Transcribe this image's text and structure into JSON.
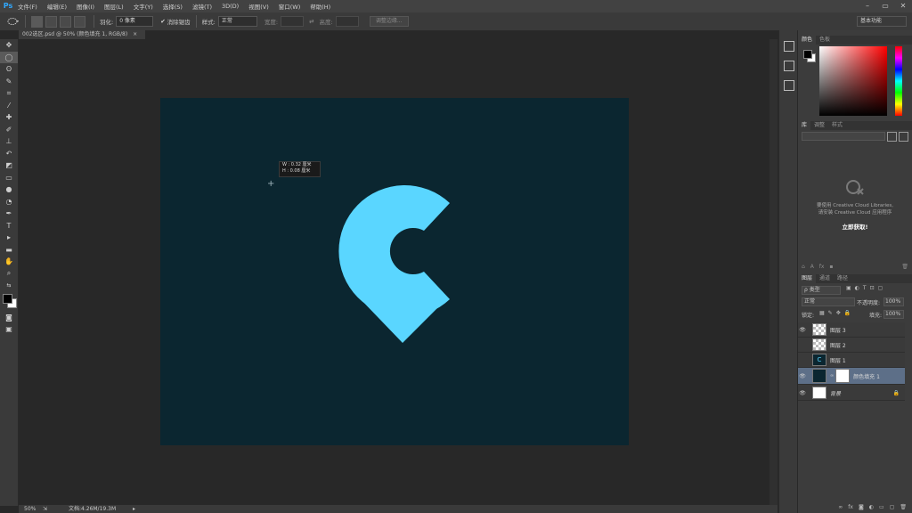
{
  "app": {
    "logo": "Ps"
  },
  "menu": [
    "文件(F)",
    "编辑(E)",
    "图像(I)",
    "图层(L)",
    "文字(Y)",
    "选择(S)",
    "滤镜(T)",
    "3D(D)",
    "视图(V)",
    "窗口(W)",
    "帮助(H)"
  ],
  "window_controls": [
    "–",
    "▭",
    "✕"
  ],
  "options": {
    "feather_label": "羽化:",
    "feather_value": "0 像素",
    "antialias_label": "消除锯齿",
    "style_label": "样式:",
    "style_value": "正常",
    "width_label": "宽度:",
    "height_label": "高度:",
    "refine_edge": "调整边缘...",
    "workspace": "基本功能"
  },
  "document": {
    "tab_title": "002选区.psd @ 50% (颜色填充 1, RGB/8)",
    "tab_close": "×",
    "canvas_color": "#0b2630",
    "shape_color": "#5ad6ff",
    "tooltip_w": "W :  0.32 厘米",
    "tooltip_h": "H :  0.08 厘米"
  },
  "status": {
    "zoom": "50%",
    "doc_info": "文档:4.26M/19.3M"
  },
  "color_panel": {
    "tabs": [
      "颜色",
      "色板"
    ]
  },
  "libraries_panel": {
    "tabs": [
      "库",
      "调整",
      "样式"
    ],
    "message_line1": "要使用 Creative Cloud Libraries,",
    "message_line2": "请安装 Creative Cloud 应用程序",
    "action": "立即获取!"
  },
  "layers_panel": {
    "tabs": [
      "图层",
      "通道",
      "路径"
    ],
    "filter_label": "ρ 类型",
    "blend_mode": "正常",
    "opacity_label": "不透明度:",
    "opacity_value": "100%",
    "lock_label": "锁定:",
    "fill_label": "填充:",
    "fill_value": "100%",
    "layers": [
      {
        "name": "图层 3",
        "visible": true
      },
      {
        "name": "图层 2",
        "visible": false
      },
      {
        "name": "图层 1",
        "visible": false
      },
      {
        "name": "颜色填充 1",
        "visible": true,
        "selected": true
      },
      {
        "name": "背景",
        "visible": true,
        "locked": true
      }
    ]
  }
}
